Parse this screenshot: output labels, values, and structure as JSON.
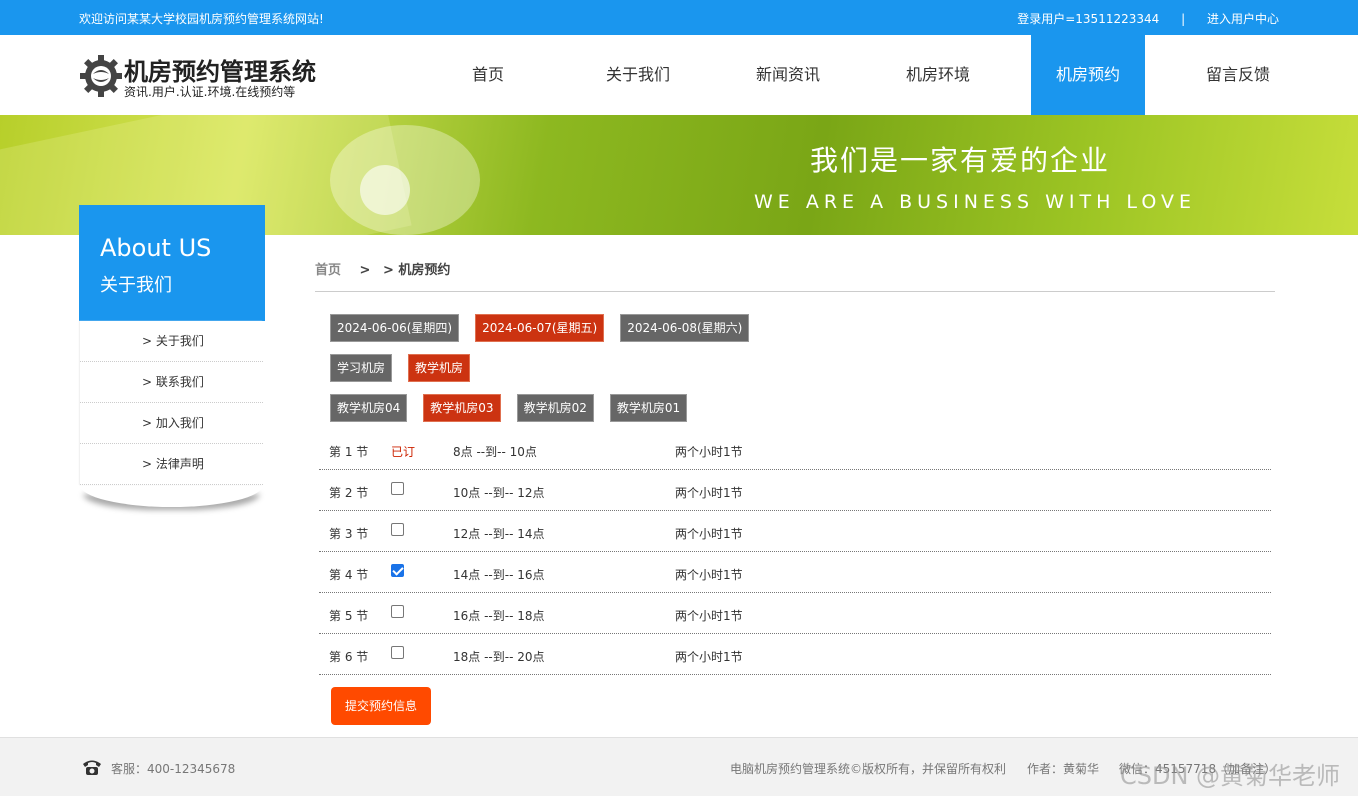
{
  "topbar": {
    "welcome": "欢迎访问某某大学校园机房预约管理系统网站!",
    "login_user": "登录用户=13511223344",
    "separator": "|",
    "user_center": "进入用户中心"
  },
  "header": {
    "logo_title": "机房预约管理系统",
    "logo_subtitle": "资讯.用户.认证.环境.在线预约等",
    "nav": [
      "首页",
      "关于我们",
      "新闻资讯",
      "机房环境",
      "机房预约",
      "留言反馈"
    ],
    "active_nav": "机房预约"
  },
  "banner": {
    "cn": "我们是一家有爱的企业",
    "en": "WE ARE A BUSINESS WITH LOVE"
  },
  "sidebar": {
    "title_en": "About US",
    "title_cn": "关于我们",
    "items": [
      "> 关于我们",
      "> 联系我们",
      "> 加入我们",
      "> 法律声明"
    ]
  },
  "breadcrumb": {
    "home": "首页",
    "gt": ">",
    "current": "> 机房预约"
  },
  "dates": [
    {
      "label": "2024-06-06(星期四)",
      "selected": false
    },
    {
      "label": "2024-06-07(星期五)",
      "selected": true
    },
    {
      "label": "2024-06-08(星期六)",
      "selected": false
    }
  ],
  "room_types": [
    {
      "label": "学习机房",
      "selected": false
    },
    {
      "label": "教学机房",
      "selected": true
    }
  ],
  "rooms": [
    {
      "label": "教学机房04",
      "selected": false
    },
    {
      "label": "教学机房03",
      "selected": true
    },
    {
      "label": "教学机房02",
      "selected": false
    },
    {
      "label": "教学机房01",
      "selected": false
    }
  ],
  "slots": [
    {
      "num": "第 1 节",
      "status": "已订",
      "checked": false,
      "time": "8点 --到-- 10点",
      "duration": "两个小时1节"
    },
    {
      "num": "第 2 节",
      "status": "",
      "checked": false,
      "time": "10点 --到-- 12点",
      "duration": "两个小时1节"
    },
    {
      "num": "第 3 节",
      "status": "",
      "checked": false,
      "time": "12点 --到-- 14点",
      "duration": "两个小时1节"
    },
    {
      "num": "第 4 节",
      "status": "",
      "checked": true,
      "time": "14点 --到-- 16点",
      "duration": "两个小时1节"
    },
    {
      "num": "第 5 节",
      "status": "",
      "checked": false,
      "time": "16点 --到-- 18点",
      "duration": "两个小时1节"
    },
    {
      "num": "第 6 节",
      "status": "",
      "checked": false,
      "time": "18点 --到-- 20点",
      "duration": "两个小时1节"
    }
  ],
  "submit_label": "提交预约信息",
  "footer": {
    "service": "客服：400-12345678",
    "copyright": "电脑机房预约管理系统©版权所有，并保留所有权利",
    "author": "作者：黄菊华",
    "wechat": "微信：45157718（加备注）"
  },
  "watermark": "CSDN @黄菊华老师",
  "colors": {
    "primary": "#1a96ee",
    "selected": "#cc3311",
    "submit": "#ff4a00",
    "booked": "#cc2200"
  }
}
